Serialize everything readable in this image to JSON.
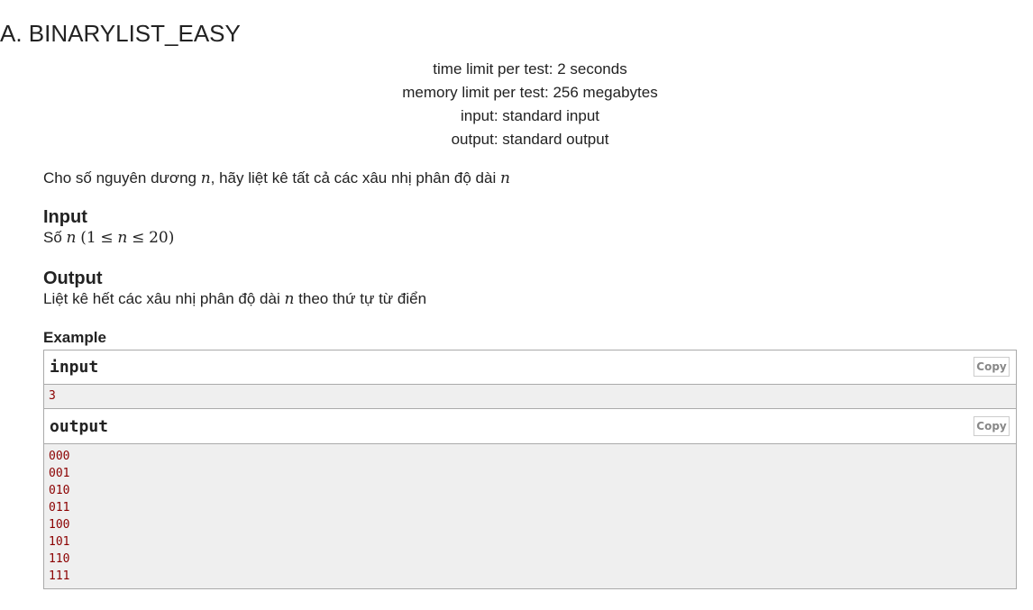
{
  "problem": {
    "title": "A. BINARYLIST_EASY",
    "time_limit": "time limit per test: 2 seconds",
    "memory_limit": "memory limit per test: 256 megabytes",
    "input_file": "input: standard input",
    "output_file": "output: standard output"
  },
  "statement": {
    "part1": "Cho số nguyên dương ",
    "var_n": "n",
    "part2": ", hãy liệt kê tất cả các xâu nhị phân độ dài "
  },
  "input_section": {
    "title": "Input",
    "text_prefix": "Số ",
    "constraint_open": "(",
    "constraint_low": "1",
    "leq": "≤",
    "var": "n",
    "constraint_high": "20",
    "constraint_close": ")"
  },
  "output_section": {
    "title": "Output",
    "text_prefix": "Liệt kê hết các xâu nhị phân độ dài ",
    "var": "n",
    "text_suffix": " theo thứ tự từ điển"
  },
  "example": {
    "title": "Example",
    "input_label": "input",
    "output_label": "output",
    "copy_label": "Copy",
    "input_lines": [
      "3"
    ],
    "output_lines": [
      "000",
      "001",
      "010",
      "011",
      "100",
      "101",
      "110",
      "111"
    ]
  }
}
